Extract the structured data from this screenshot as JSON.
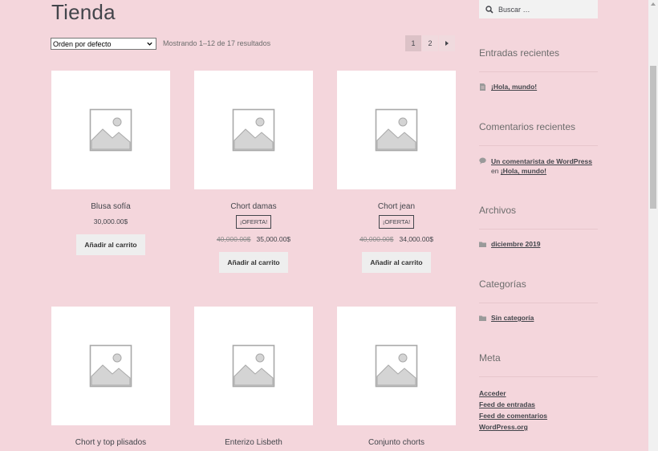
{
  "title": "Tienda",
  "toolbar": {
    "sort_value": "Orden por defecto",
    "result_count": "Mostrando 1–12 de 17 resultados"
  },
  "pagination": {
    "pages": [
      "1",
      "2"
    ],
    "current": "1",
    "next_icon": "chevron-right-icon"
  },
  "products": [
    {
      "name": "Blusa sofía",
      "price": "30,000.00$",
      "button": "Añadir al carrito"
    },
    {
      "name": "Chort damas",
      "sale_badge": "¡OFERTA!",
      "old_price": "40,000.00$",
      "price": "35,000.00$",
      "button": "Añadir al carrito"
    },
    {
      "name": "Chort jean",
      "sale_badge": "¡OFERTA!",
      "old_price": "40,000.00$",
      "price": "34,000.00$",
      "button": "Añadir al carrito"
    },
    {
      "name": "Chort y top plisados"
    },
    {
      "name": "Enterizo Lisbeth"
    },
    {
      "name": "Conjunto chorts"
    }
  ],
  "sidebar": {
    "search_placeholder": "Buscar …",
    "recent_posts": {
      "title": "Entradas recientes",
      "items": [
        "¡Hola, mundo!"
      ]
    },
    "recent_comments": {
      "title": "Comentarios recientes",
      "author": "Un comentarista de WordPress",
      "connector": "en",
      "post": "¡Hola, mundo!"
    },
    "archives": {
      "title": "Archivos",
      "items": [
        "diciembre 2019"
      ]
    },
    "categories": {
      "title": "Categorías",
      "items": [
        "Sin categoría"
      ]
    },
    "meta": {
      "title": "Meta",
      "items": [
        "Acceder",
        "Feed de entradas",
        "Feed de comentarios",
        "WordPress.org"
      ]
    }
  },
  "colors": {
    "background": "#f4d6dc",
    "text": "#43454b",
    "button_bg": "#eeeeee"
  }
}
